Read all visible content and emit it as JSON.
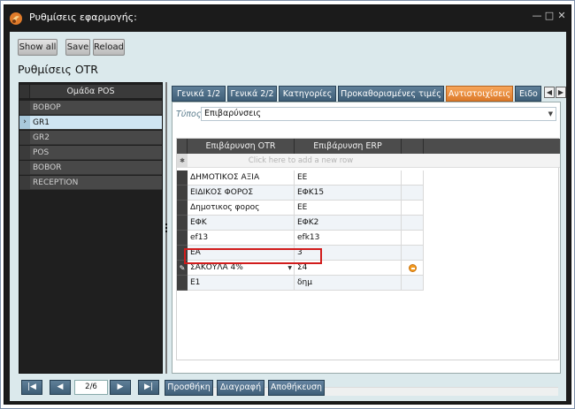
{
  "window": {
    "title": "Ρυθμίσεις εφαρμογής:"
  },
  "toolbar": {
    "show_all": "Show all",
    "save": "Save",
    "reload": "Reload"
  },
  "page_title": "Ρυθμίσεις OTR",
  "left_grid": {
    "header": "Ομάδα POS",
    "rows": [
      "BOBOP",
      "GR1",
      "GR2",
      "POS",
      "BOBOR",
      "RECEPTION"
    ],
    "selected_index": 1
  },
  "tabs": [
    "Γενικά 1/2",
    "Γενικά 2/2",
    "Κατηγορίες",
    "Προκαθορισμένες τιμές",
    "Αντιστοιχίσεις",
    "Ειδο"
  ],
  "active_tab_index": 4,
  "type_filter": {
    "label": "Τύπος",
    "value": "Επιβαρύνσεις"
  },
  "main_grid": {
    "columns": [
      "Επιβάρυνση OTR",
      "Επιβάρυνση ERP"
    ],
    "new_row_text": "Click here to add a new row",
    "rows": [
      {
        "otr": "ΔΗΜΟΤΙΚΟΣ ΑΞΙΑ",
        "erp": "ΕΕ"
      },
      {
        "otr": "ΕΙΔΙΚΟΣ ΦΟΡΟΣ",
        "erp": "ΕΦΚ15"
      },
      {
        "otr": "Δημοτικος φορος",
        "erp": "ΕΕ"
      },
      {
        "otr": "ΕΦΚ",
        "erp": "ΕΦΚ2"
      },
      {
        "otr": "ef13",
        "erp": "efk13"
      },
      {
        "otr": "ΕΑ",
        "erp": "3"
      },
      {
        "otr": "ΣΑΚΟΥΛΑ 4%",
        "erp": "Σ4"
      },
      {
        "otr": "Ε1",
        "erp": "δημ"
      }
    ],
    "edit_row_index": 6
  },
  "pager": {
    "value": "2/6"
  },
  "actions": {
    "add": "Προσθήκη",
    "delete": "Διαγραφή",
    "save": "Αποθήκευση"
  },
  "colors": {
    "accent_tab": "#f39a4a",
    "tab": "#4f6f88",
    "highlight": "#d11c1c",
    "panel_bg": "#dbe9ec"
  }
}
